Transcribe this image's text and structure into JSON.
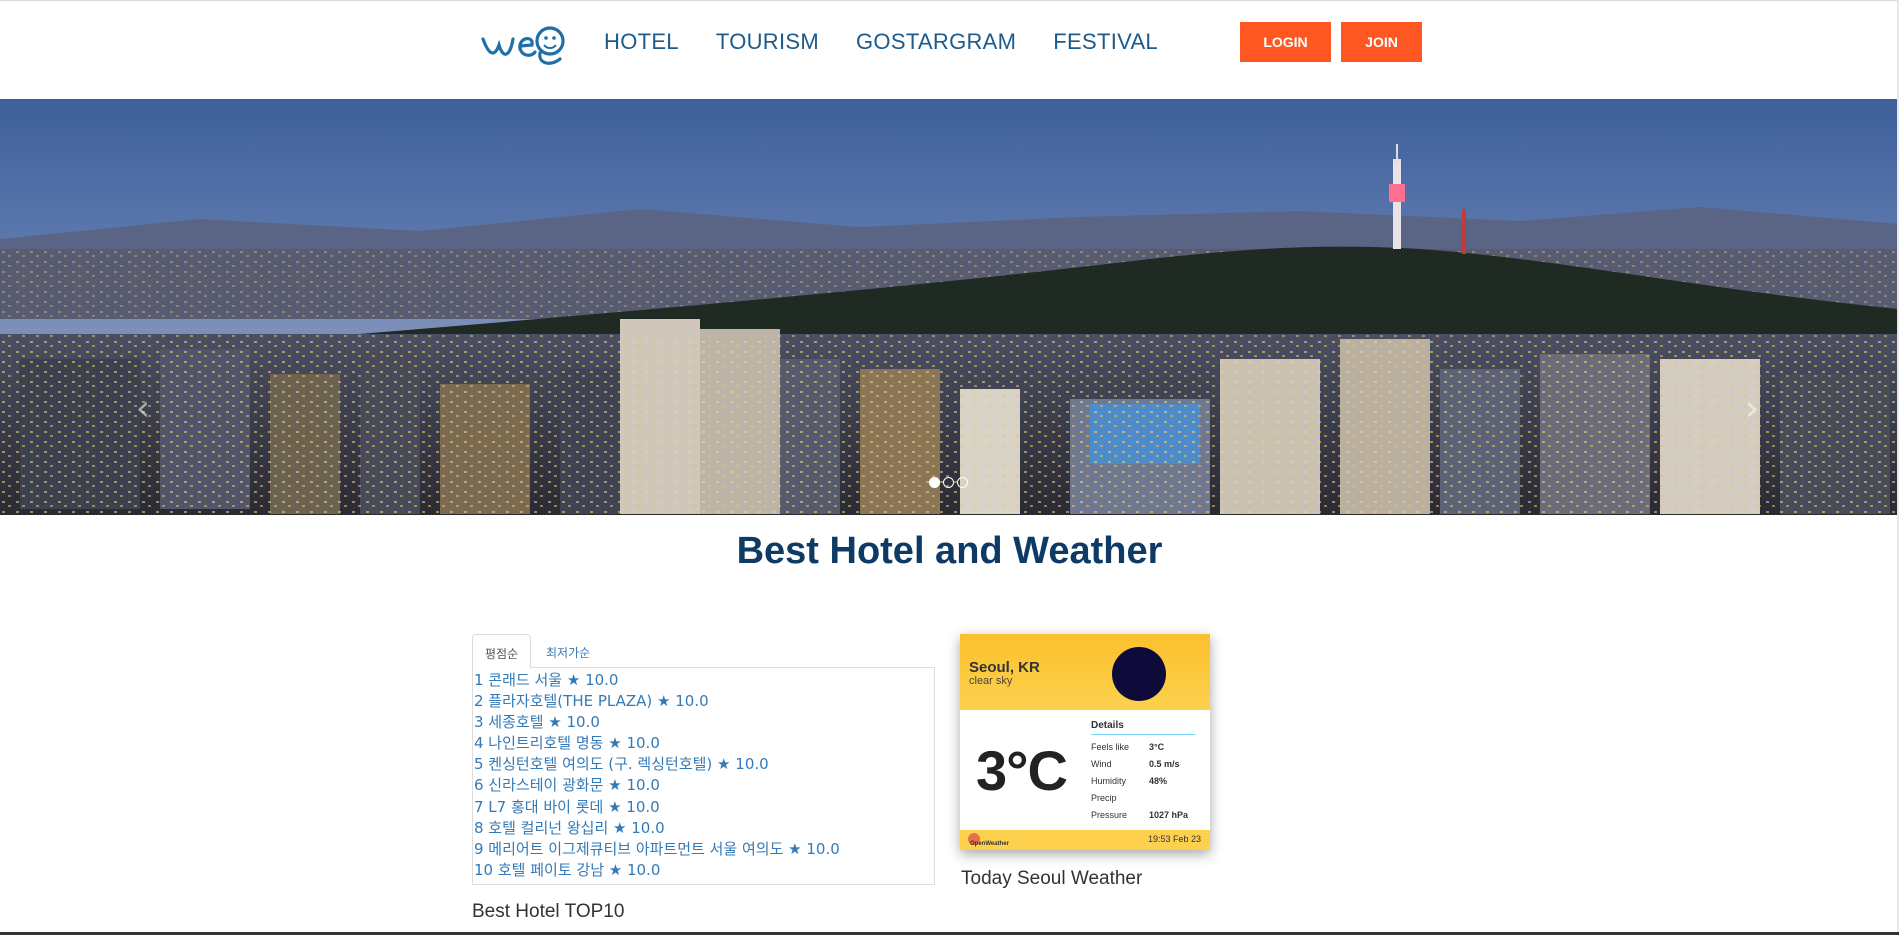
{
  "header": {
    "logo_label": "weg logo",
    "nav": [
      "HOTEL",
      "TOURISM",
      "GOSTARGRAM",
      "FESTIVAL"
    ],
    "login_label": "LOGIN",
    "join_label": "JOIN"
  },
  "carousel": {
    "prev_icon": "‹",
    "next_icon": "›",
    "slide_count": 3,
    "active_slide": 1
  },
  "main": {
    "title": "Best Hotel and Weather",
    "tabs": [
      "평점순",
      "최저가순"
    ],
    "hotels": [
      "1 콘래드 서울 ★ 10.0",
      "2 플라자호텔(THE PLAZA) ★ 10.0",
      "3 세종호텔 ★ 10.0",
      "4 나인트리호텔 명동 ★ 10.0",
      "5 켄싱턴호텔 여의도 (구. 렉싱턴호텔) ★ 10.0",
      "6 신라스테이 광화문 ★ 10.0",
      "7 L7 홍대 바이 롯데 ★ 10.0",
      "8 호텔 컬리넌 왕십리 ★ 10.0",
      "9 메리어트 이그제큐티브 아파트먼트 서울 여의도 ★ 10.0",
      "10 호텔 페이토 강남 ★ 10.0"
    ],
    "list_caption": "Best Hotel TOP10"
  },
  "weather": {
    "city": "Seoul, KR",
    "description": "clear sky",
    "temperature": "3°C",
    "details_title": "Details",
    "details": [
      {
        "label": "Feels like",
        "value": "3°C"
      },
      {
        "label": "Wind",
        "value": "0.5 m/s"
      },
      {
        "label": "Humidity",
        "value": "48%"
      },
      {
        "label": "Precip",
        "value": ""
      },
      {
        "label": "Pressure",
        "value": "1027 hPa"
      }
    ],
    "brand": "OpenWeather",
    "updated": "19:53 Feb 23",
    "caption": "Today Seoul Weather"
  },
  "colors": {
    "accent": "#ff5722",
    "nav": "#1e5a8a",
    "title": "#0d3b66",
    "link": "#337ab7",
    "weather_top": "#fbc02d"
  }
}
